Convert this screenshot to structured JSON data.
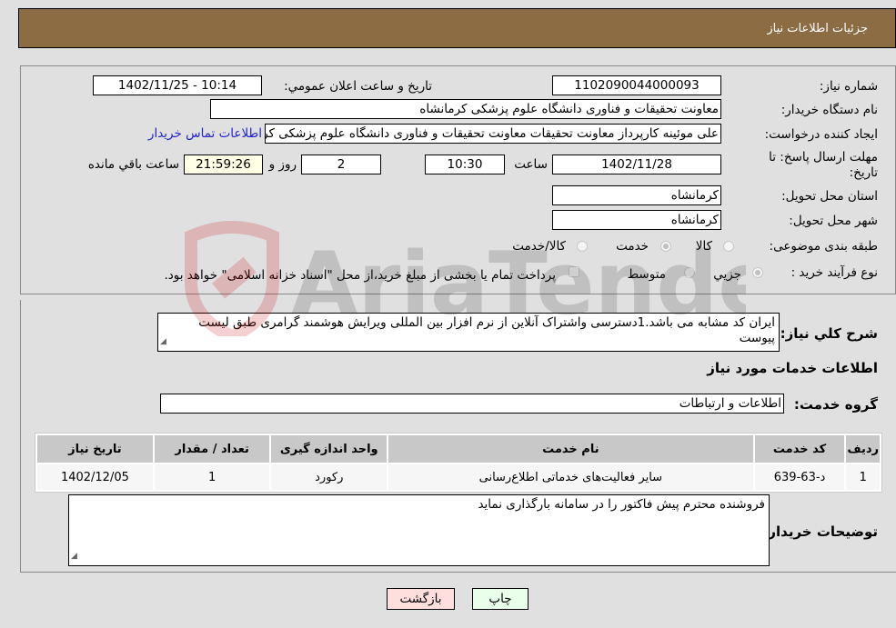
{
  "header": {
    "title": "جزئیات اطلاعات نیاز"
  },
  "colors": {
    "header_bg": "#8c6c43",
    "link": "#2222cc",
    "back_button_bg": "#ffdede",
    "print_button_bg": "#eaffea",
    "remaining_bg": "#ffffe6"
  },
  "fields": {
    "need_number": {
      "label": "شماره نیاز:",
      "value": "1102090044000093"
    },
    "announce_datetime": {
      "label": "تاریخ و ساعت اعلان عمومي:",
      "value": "1402/11/25 - 10:14"
    },
    "buyer_org": {
      "label": "نام دستگاه خریدار:",
      "value": "معاونت تحقیقات و فناوری دانشگاه علوم پزشکی کرمانشاه"
    },
    "requester": {
      "label": "ایجاد کننده درخواست:",
      "value": "علی موئینه کارپرداز معاونت تحقیقات معاونت تحقیقات و فناوری دانشگاه علوم پزشکی کرمانشاه",
      "contact_link": "اطلاعات تماس خریدار"
    },
    "deadline": {
      "label_line1": "مهلت ارسال پاسخ: تا",
      "label_line2": "تاریخ:",
      "date": "1402/11/28",
      "time_label": "ساعت",
      "time": "10:30",
      "days": "2",
      "days_label": "روز و",
      "remaining": "21:59:26",
      "remaining_label": "ساعت باقي مانده"
    },
    "province": {
      "label": "استان محل تحویل:",
      "value": "کرمانشاه"
    },
    "city": {
      "label": "شهر محل تحویل:",
      "value": "کرمانشاه"
    },
    "category": {
      "label": "طبقه بندی موضوعی:",
      "options": [
        "کالا",
        "خدمت",
        "کالا/خدمت"
      ],
      "selected": "خدمت"
    },
    "purchase_type": {
      "label": "نوع فرآیند خرید :",
      "options": [
        "جزيي",
        "متوسط"
      ],
      "selected": "جزيي",
      "treasury_note": "پرداخت تمام یا بخشی از مبلغ خرید،از محل \"اسناد خزانه اسلامی\" خواهد بود."
    }
  },
  "description": {
    "label": "شرح كلي نياز:",
    "value": "ایران کد مشابه می باشد.1دسترسی واشتراک آنلاین از نرم افزار بین المللی ویرایش هوشمند گرامری  طبق لیست پیوست"
  },
  "services_section": {
    "title": "اطلاعات خدمات مورد نیاز",
    "group_label": "گروه خدمت:",
    "group_value": "اطلاعات و ارتباطات",
    "table": {
      "headers": [
        "ردیف",
        "کد خدمت",
        "نام خدمت",
        "واحد اندازه گیری",
        "تعداد / مقدار",
        "تاریخ نیاز"
      ],
      "rows": [
        [
          "1",
          "د-63-639",
          "سایر فعالیت‌های خدماتی اطلاع‌رسانی",
          "رکورد",
          "1",
          "1402/12/05"
        ]
      ]
    }
  },
  "buyer_notes": {
    "label": "توضیحات خریدار:",
    "value": "فروشنده محترم پیش فاکتور را در سامانه بارگذاری نماید"
  },
  "buttons": {
    "print": "چاپ",
    "back": "بازگشت"
  },
  "watermark": {
    "text": "AriaTender.neT"
  }
}
